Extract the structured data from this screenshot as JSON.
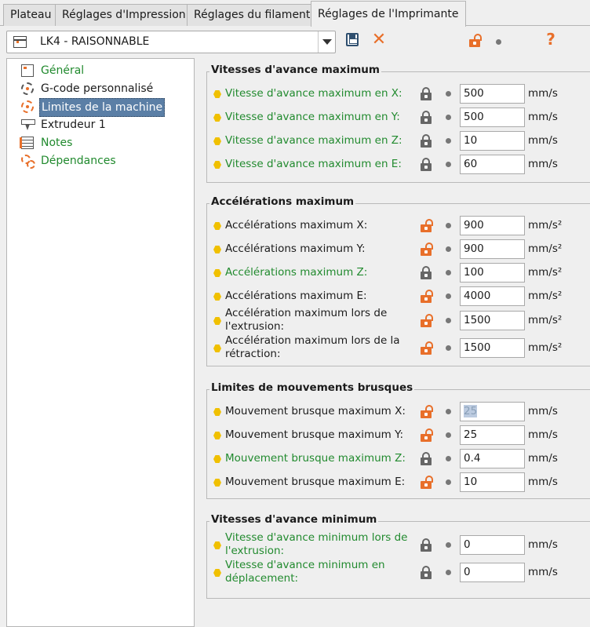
{
  "tabs": [
    {
      "label": "Plateau"
    },
    {
      "label": "Réglages d'Impression"
    },
    {
      "label": "Réglages du filament"
    },
    {
      "label": "Réglages de l'Imprimante"
    }
  ],
  "preset": {
    "value": "LK4 - RAISONNABLE"
  },
  "toolbar": {
    "help_label": "?"
  },
  "tree": [
    {
      "label": "Général",
      "icon": "page-icon"
    },
    {
      "label": "G-code personnalisé",
      "icon": "gear-icon"
    },
    {
      "label": "Limites de la machine",
      "icon": "gear-icon"
    },
    {
      "label": "Extrudeur 1",
      "icon": "nozzle-icon"
    },
    {
      "label": "Notes",
      "icon": "notes-icon"
    },
    {
      "label": "Dépendances",
      "icon": "dependencies-icon"
    }
  ],
  "groups": [
    {
      "title": "Vitesses d'avance maximum",
      "rows": [
        {
          "label": "Vitesse d'avance maximum en X:",
          "value": "500",
          "unit": "mm/s"
        },
        {
          "label": "Vitesse d'avance maximum en Y:",
          "value": "500",
          "unit": "mm/s"
        },
        {
          "label": "Vitesse d'avance maximum en Z:",
          "value": "10",
          "unit": "mm/s"
        },
        {
          "label": "Vitesse d'avance maximum en E:",
          "value": "60",
          "unit": "mm/s"
        }
      ]
    },
    {
      "title": "Accélérations maximum",
      "rows": [
        {
          "label": "Accélérations maximum X:",
          "value": "900",
          "unit": "mm/s²"
        },
        {
          "label": "Accélérations maximum Y:",
          "value": "900",
          "unit": "mm/s²"
        },
        {
          "label": "Accélérations maximum Z:",
          "value": "100",
          "unit": "mm/s²"
        },
        {
          "label": "Accélérations maximum E:",
          "value": "4000",
          "unit": "mm/s²"
        },
        {
          "label": "Accélération maximum lors de l'extrusion:",
          "value": "1500",
          "unit": "mm/s²"
        },
        {
          "label": "Accélération maximum lors de la rétraction:",
          "value": "1500",
          "unit": "mm/s²"
        }
      ]
    },
    {
      "title": "Limites de mouvements brusques",
      "rows": [
        {
          "label": "Mouvement brusque maximum X:",
          "value": "25",
          "unit": "mm/s"
        },
        {
          "label": "Mouvement brusque maximum Y:",
          "value": "25",
          "unit": "mm/s"
        },
        {
          "label": "Mouvement brusque maximum Z:",
          "value": "0.4",
          "unit": "mm/s"
        },
        {
          "label": "Mouvement brusque maximum E:",
          "value": "10",
          "unit": "mm/s"
        }
      ]
    },
    {
      "title": "Vitesses d'avance minimum",
      "rows": [
        {
          "label": "Vitesse d'avance minimum lors de l'extrusion:",
          "value": "0",
          "unit": "mm/s"
        },
        {
          "label": "Vitesse d'avance minimum en déplacement:",
          "value": "0",
          "unit": "mm/s"
        }
      ]
    }
  ],
  "colors": {
    "modified_orange": "#e86f2a",
    "system_green": "#218a2e",
    "hex_yellow": "#f0c000",
    "selection_blue": "#5b7fa6"
  }
}
